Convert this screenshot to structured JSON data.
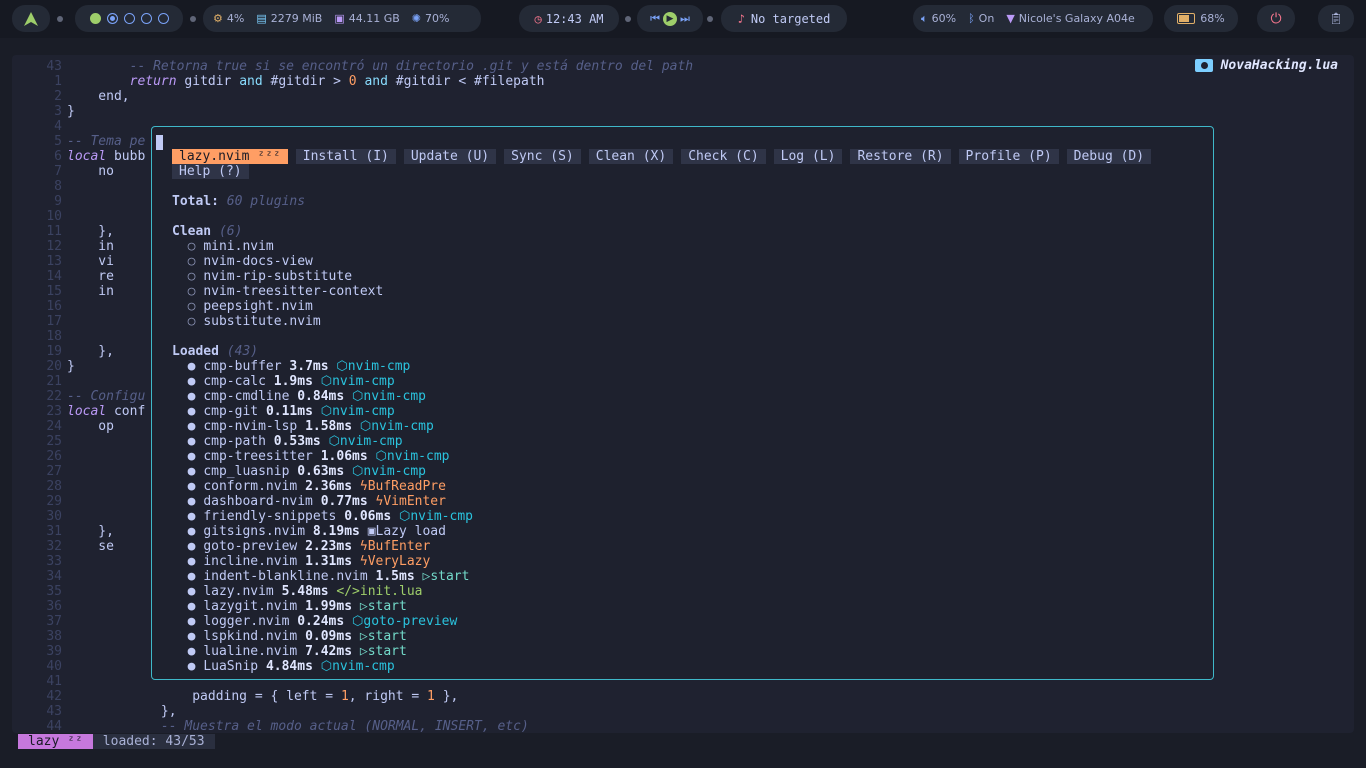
{
  "topbar": {
    "workspaces": [
      "g",
      "a",
      "b",
      "c",
      "d"
    ],
    "cpu": "4%",
    "memory": "2279 MiB",
    "disk": "44.11 GB",
    "temp": "70%",
    "clock": "12:43 AM",
    "media_status": "No targeted",
    "volume": "60%",
    "bluetooth": "On",
    "wifi": "Nicole's Galaxy A04e",
    "battery": "68%",
    "accent": "#7aa2f7"
  },
  "editor": {
    "filename": "NovaHacking.lua",
    "top_lines": [
      {
        "n": "43",
        "code": "        -- Retorna true si se encontró un directorio .git y está dentro del path",
        "kind": "comment"
      },
      {
        "n": "1",
        "code": "        return gitdir and #gitdir > 0 and #gitdir < #filepath",
        "kind": "return"
      },
      {
        "n": "2",
        "code": "    end,",
        "kind": "plain"
      },
      {
        "n": "3",
        "code": "}",
        "kind": "plain"
      },
      {
        "n": "4",
        "code": "",
        "kind": "plain"
      },
      {
        "n": "5",
        "code": "-- Tema pe",
        "kind": "comment"
      },
      {
        "n": "6",
        "code": "local bubb",
        "kind": "local"
      },
      {
        "n": "7",
        "code": "    no",
        "kind": "plain"
      },
      {
        "n": "8",
        "code": "",
        "kind": "plain"
      },
      {
        "n": "9",
        "code": "",
        "kind": "plain"
      },
      {
        "n": "10",
        "code": "",
        "kind": "plain"
      },
      {
        "n": "11",
        "code": "    },",
        "kind": "plain"
      },
      {
        "n": "12",
        "code": "    in",
        "kind": "plain"
      },
      {
        "n": "13",
        "code": "    vi",
        "kind": "plain"
      },
      {
        "n": "14",
        "code": "    re",
        "kind": "plain"
      },
      {
        "n": "15",
        "code": "    in",
        "kind": "plain"
      },
      {
        "n": "16",
        "code": "",
        "kind": "plain"
      },
      {
        "n": "17",
        "code": "",
        "kind": "plain"
      },
      {
        "n": "18",
        "code": "",
        "kind": "plain"
      },
      {
        "n": "19",
        "code": "    },",
        "kind": "plain"
      },
      {
        "n": "20",
        "code": "}",
        "kind": "plain"
      },
      {
        "n": "21",
        "code": "",
        "kind": "plain"
      },
      {
        "n": "22",
        "code": "-- Configu",
        "kind": "comment"
      },
      {
        "n": "23",
        "code": "local conf",
        "kind": "local"
      },
      {
        "n": "24",
        "code": "    op",
        "kind": "plain"
      },
      {
        "n": "25",
        "code": "",
        "kind": "plain"
      },
      {
        "n": "26",
        "code": "",
        "kind": "plain"
      },
      {
        "n": "27",
        "code": "",
        "kind": "plain"
      },
      {
        "n": "28",
        "code": "",
        "kind": "plain"
      },
      {
        "n": "29",
        "code": "",
        "kind": "plain"
      },
      {
        "n": "30",
        "code": "",
        "kind": "plain"
      },
      {
        "n": "31",
        "code": "    },",
        "kind": "plain"
      },
      {
        "n": "32",
        "code": "    se",
        "kind": "plain"
      },
      {
        "n": "33",
        "code": "",
        "kind": "plain"
      },
      {
        "n": "34",
        "code": "",
        "kind": "plain"
      },
      {
        "n": "35",
        "code": "",
        "kind": "plain"
      },
      {
        "n": "36",
        "code": "",
        "kind": "plain"
      },
      {
        "n": "37",
        "code": "",
        "kind": "plain"
      },
      {
        "n": "38",
        "code": "",
        "kind": "plain"
      },
      {
        "n": "39",
        "code": "",
        "kind": "plain"
      },
      {
        "n": "40",
        "code": "",
        "kind": "plain"
      },
      {
        "n": "41",
        "code": "",
        "kind": "plain"
      },
      {
        "n": "42",
        "code": "                padding = { left = 1, right = 1 },",
        "kind": "padding"
      },
      {
        "n": "43",
        "code": "            },",
        "kind": "plain"
      },
      {
        "n": "44",
        "code": "            -- Muestra el modo actual (NORMAL, INSERT, etc)",
        "kind": "comment"
      }
    ]
  },
  "lazy": {
    "buttons": [
      {
        "label": "lazy.nvim ᶻᶻᶻ",
        "active": true
      },
      {
        "label": "Install (I)"
      },
      {
        "label": "Update (U)"
      },
      {
        "label": "Sync (S)"
      },
      {
        "label": "Clean (X)"
      },
      {
        "label": "Check (C)"
      },
      {
        "label": "Log (L)"
      },
      {
        "label": "Restore (R)"
      },
      {
        "label": "Profile (P)"
      },
      {
        "label": "Debug (D)"
      },
      {
        "label": "Help (?)"
      }
    ],
    "total_label": "Total:",
    "total_value": "60 plugins",
    "clean_label": "Clean",
    "clean_count": "(6)",
    "clean_items": [
      "mini.nvim",
      "nvim-docs-view",
      "nvim-rip-substitute",
      "nvim-treesitter-context",
      "peepsight.nvim",
      "substitute.nvim"
    ],
    "loaded_label": "Loaded",
    "loaded_count": "(43)",
    "loaded_items": [
      {
        "name": "cmp-buffer",
        "time": "3.7ms",
        "icon": "⬡",
        "src": "nvim-cmp",
        "kind": "plugin"
      },
      {
        "name": "cmp-calc",
        "time": "1.9ms",
        "icon": "⬡",
        "src": "nvim-cmp",
        "kind": "plugin"
      },
      {
        "name": "cmp-cmdline",
        "time": "0.84ms",
        "icon": "⬡",
        "src": "nvim-cmp",
        "kind": "plugin"
      },
      {
        "name": "cmp-git",
        "time": "0.11ms",
        "icon": "⬡",
        "src": "nvim-cmp",
        "kind": "plugin"
      },
      {
        "name": "cmp-nvim-lsp",
        "time": "1.58ms",
        "icon": "⬡",
        "src": "nvim-cmp",
        "kind": "plugin"
      },
      {
        "name": "cmp-path",
        "time": "0.53ms",
        "icon": "⬡",
        "src": "nvim-cmp",
        "kind": "plugin"
      },
      {
        "name": "cmp-treesitter",
        "time": "1.06ms",
        "icon": "⬡",
        "src": "nvim-cmp",
        "kind": "plugin"
      },
      {
        "name": "cmp_luasnip",
        "time": "0.63ms",
        "icon": "⬡",
        "src": "nvim-cmp",
        "kind": "plugin"
      },
      {
        "name": "conform.nvim",
        "time": "2.36ms",
        "icon": "ϟ",
        "src": "BufReadPre",
        "kind": "event"
      },
      {
        "name": "dashboard-nvim",
        "time": "0.77ms",
        "icon": "ϟ",
        "src": "VimEnter",
        "kind": "event"
      },
      {
        "name": "friendly-snippets",
        "time": "0.06ms",
        "icon": "⬡",
        "src": "nvim-cmp",
        "kind": "plugin"
      },
      {
        "name": "gitsigns.nvim",
        "time": "8.19ms",
        "icon": "▣",
        "src": "Lazy load",
        "kind": "cmd"
      },
      {
        "name": "goto-preview",
        "time": "2.23ms",
        "icon": "ϟ",
        "src": "BufEnter",
        "kind": "event"
      },
      {
        "name": "incline.nvim",
        "time": "1.31ms",
        "icon": "ϟ",
        "src": "VeryLazy",
        "kind": "event"
      },
      {
        "name": "indent-blankline.nvim",
        "time": "1.5ms",
        "icon": "▷",
        "src": "start",
        "kind": "start"
      },
      {
        "name": "lazy.nvim",
        "time": "5.48ms",
        "icon": "</>",
        "src": "init.lua",
        "kind": "init"
      },
      {
        "name": "lazygit.nvim",
        "time": "1.99ms",
        "icon": "▷",
        "src": "start",
        "kind": "start"
      },
      {
        "name": "logger.nvim",
        "time": "0.24ms",
        "icon": "⬡",
        "src": "goto-preview",
        "kind": "plugin"
      },
      {
        "name": "lspkind.nvim",
        "time": "0.09ms",
        "icon": "▷",
        "src": "start",
        "kind": "start"
      },
      {
        "name": "lualine.nvim",
        "time": "7.42ms",
        "icon": "▷",
        "src": "start",
        "kind": "start"
      },
      {
        "name": "LuaSnip",
        "time": "4.84ms",
        "icon": "⬡",
        "src": "nvim-cmp",
        "kind": "plugin"
      }
    ]
  },
  "statusline": {
    "mode": "lazy ᶻᶻ",
    "info": "loaded: 43/53"
  }
}
